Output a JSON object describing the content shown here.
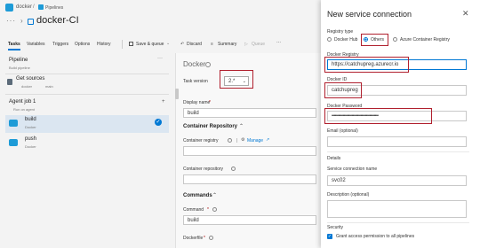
{
  "header": {
    "crumb_project": "docker",
    "crumb_sep": "/",
    "crumb_pipelines": "Pipelines",
    "title": "docker-CI"
  },
  "tabs": [
    "Tasks",
    "Variables",
    "Triggers",
    "Options",
    "History"
  ],
  "toolbar": {
    "save_queue": "Save & queue",
    "discard": "Discard",
    "summary": "Summary",
    "queue": "Queue",
    "more": "..."
  },
  "left": {
    "pipeline_title": "Pipeline",
    "pipeline_sub": "Build pipeline",
    "get_sources": "Get sources",
    "get_sources_sub_repo": "docker",
    "get_sources_sub_branch": "main",
    "agent_job": "Agent job 1",
    "agent_job_sub": "Run on agent",
    "tasks": [
      {
        "name": "build",
        "sub": "Docker"
      },
      {
        "name": "push",
        "sub": "Docker"
      }
    ]
  },
  "middle": {
    "title": "Docker",
    "task_version_label": "Task version",
    "task_version_value": "2.*",
    "display_name_label": "Display name",
    "display_name_value": "build",
    "container_repo_section": "Container Repository",
    "container_registry_label": "Container registry",
    "manage_label": "Manage",
    "container_repository_label": "Container repository",
    "commands_section": "Commands",
    "command_label": "Command",
    "command_value": "build",
    "dockerfile_label": "Dockerfile"
  },
  "panel": {
    "title": "New service connection",
    "registry_type_label": "Registry type",
    "radio_docker_hub": "Docker Hub",
    "radio_others": "Others",
    "radio_acr": "Azure Container Registry",
    "docker_registry_label": "Docker Registry",
    "docker_registry_value": "https://catchupreg.azurecr.io",
    "docker_id_label": "Docker ID",
    "docker_id_value": "catchupreg",
    "docker_password_label": "Docker Password",
    "docker_password_value": "••••••••••••••••••••••••••••••••••••••••••",
    "email_label": "Email (optional)",
    "details_label": "Details",
    "conn_name_label": "Service connection name",
    "conn_name_value": "svc02",
    "description_label": "Description (optional)",
    "security_label": "Security",
    "grant_access_label": "Grant access permission to all pipelines"
  },
  "colors": {
    "accent": "#0078d4",
    "highlight_box": "#b0202e",
    "selected_row": "#dbe6f1"
  }
}
